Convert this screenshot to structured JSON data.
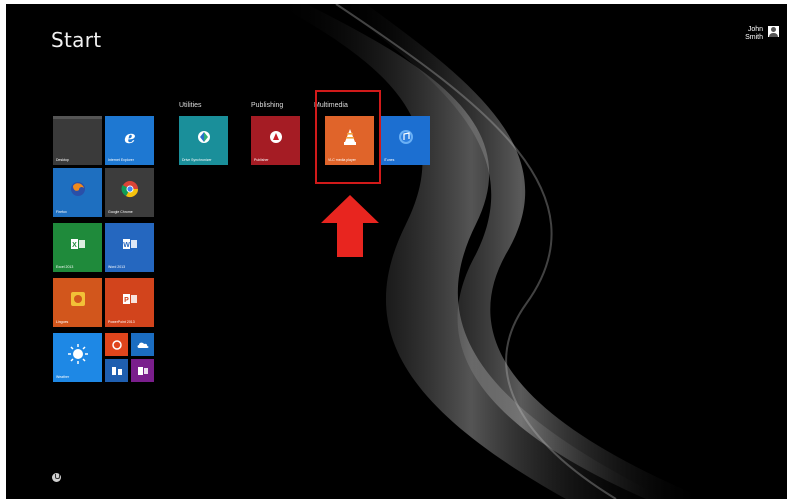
{
  "start": {
    "title": "Start"
  },
  "user": {
    "first": "John",
    "last": "Smith"
  },
  "groups": [
    {
      "label": "Utilities"
    },
    {
      "label": "Publishing"
    },
    {
      "label": "Multimedia"
    }
  ],
  "tiles": {
    "desktop": {
      "label": "Desktop",
      "color": "#3a3a3a"
    },
    "ie": {
      "label": "Internet Explorer",
      "color": "#1e78d2"
    },
    "firefox": {
      "label": "Firefox",
      "color": "#1e6fc0"
    },
    "chrome": {
      "label": "Google Chrome",
      "color": "#3c3c3c"
    },
    "excel": {
      "label": "Excel 2013",
      "color": "#1f8a3b"
    },
    "word": {
      "label": "Word 2013",
      "color": "#2567bf"
    },
    "lingoes": {
      "label": "Lingoes",
      "color": "#d2561c"
    },
    "powerpoint": {
      "label": "PowerPoint 2013",
      "color": "#d2441c"
    },
    "weather": {
      "label": "Weather",
      "color": "#1e88e5"
    },
    "mini_orange": {
      "color": "#e0451c"
    },
    "mini_blue": {
      "color": "#1b6dc1"
    },
    "mini_darkblue": {
      "color": "#1f5fb0"
    },
    "mini_purple": {
      "color": "#7a1e8c"
    },
    "utility": {
      "label": "Drive Synchronizer",
      "color": "#1a8f9a"
    },
    "publishing": {
      "label": "Publisher",
      "color": "#a51c24"
    },
    "vlc": {
      "label": "VLC media player",
      "color": "#e0642a"
    },
    "itunes": {
      "label": "iTunes",
      "color": "#1c6fd1"
    }
  },
  "annotation": {
    "highlight_color": "#d11a1a",
    "arrow_color": "#e8251f"
  }
}
